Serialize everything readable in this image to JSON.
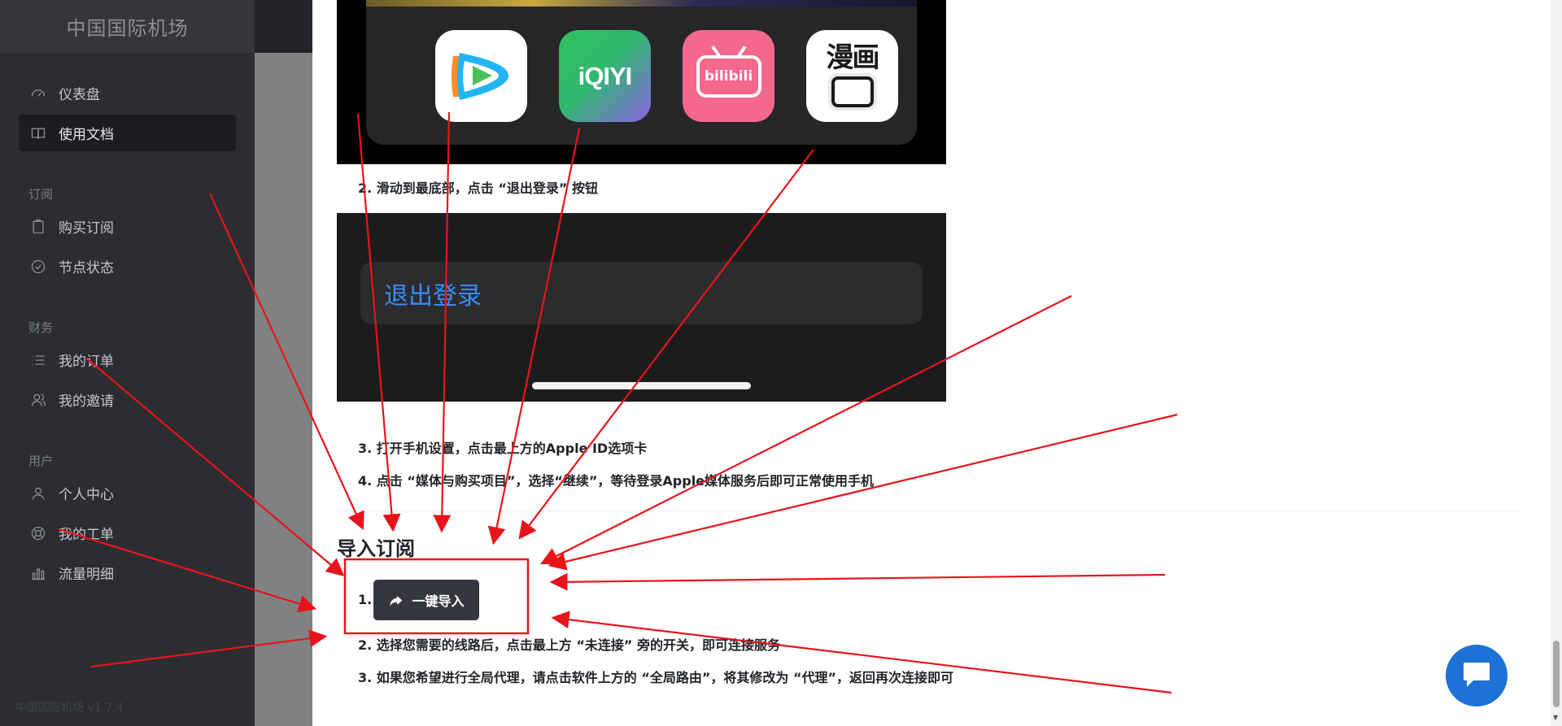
{
  "sidebar": {
    "brand": "中国国际机场",
    "items": [
      {
        "label": "仪表盘",
        "icon": "dashboard-icon"
      },
      {
        "label": "使用文档",
        "icon": "book-icon",
        "active": true
      },
      {
        "label": "购买订阅",
        "icon": "clipboard-icon"
      },
      {
        "label": "节点状态",
        "icon": "check-circle-icon"
      },
      {
        "label": "我的订单",
        "icon": "list-icon"
      },
      {
        "label": "我的邀请",
        "icon": "users-icon"
      },
      {
        "label": "个人中心",
        "icon": "user-icon"
      },
      {
        "label": "我的工单",
        "icon": "lifebuoy-icon"
      },
      {
        "label": "流量明细",
        "icon": "bar-chart-icon"
      }
    ],
    "groups": {
      "subscription": "订阅",
      "finance": "财务",
      "user": "用户"
    },
    "version": "中国国际机场 v1.7.4"
  },
  "doc": {
    "app_icons": [
      {
        "name": "tencent-video-icon",
        "colors": [
          "#ffffff",
          "#21b5f3",
          "#f58e2b",
          "#49c25a"
        ]
      },
      {
        "name": "iqiyi-icon",
        "label": "iQIYI",
        "colors": [
          "#30c15c",
          "#8d62e6"
        ]
      },
      {
        "name": "bilibili-icon",
        "label": "bilibili",
        "colors": [
          "#f3688b"
        ]
      },
      {
        "name": "manhua-icon",
        "label": "漫画",
        "colors": [
          "#ffffff",
          "#1a1a1a"
        ]
      }
    ],
    "step2": "2. 滑动到最底部，点击 “退出登录” 按钮",
    "logout_label": "退出登录",
    "step3": "3. 打开手机设置，点击最上方的Apple ID选项卡",
    "step4": "4. 点击 “媒体与购买项目”，选择“继续”，等待登录Apple媒体服务后即可正常使用手机",
    "import_title": "导入订阅",
    "import_step1_num": "1.",
    "import_button": "一键导入",
    "import_step2": "2. 选择您需要的线路后，点击最上方 “未连接” 旁的开关，即可连接服务",
    "import_step3": "3. 如果您希望进行全局代理，请点击软件上方的 “全局路由”，将其修改为 “代理”，返回再次连接即可"
  },
  "colors": {
    "annotation": "#e8141b",
    "chat": "#1d72d5",
    "sidebar": "#2b2d31"
  }
}
